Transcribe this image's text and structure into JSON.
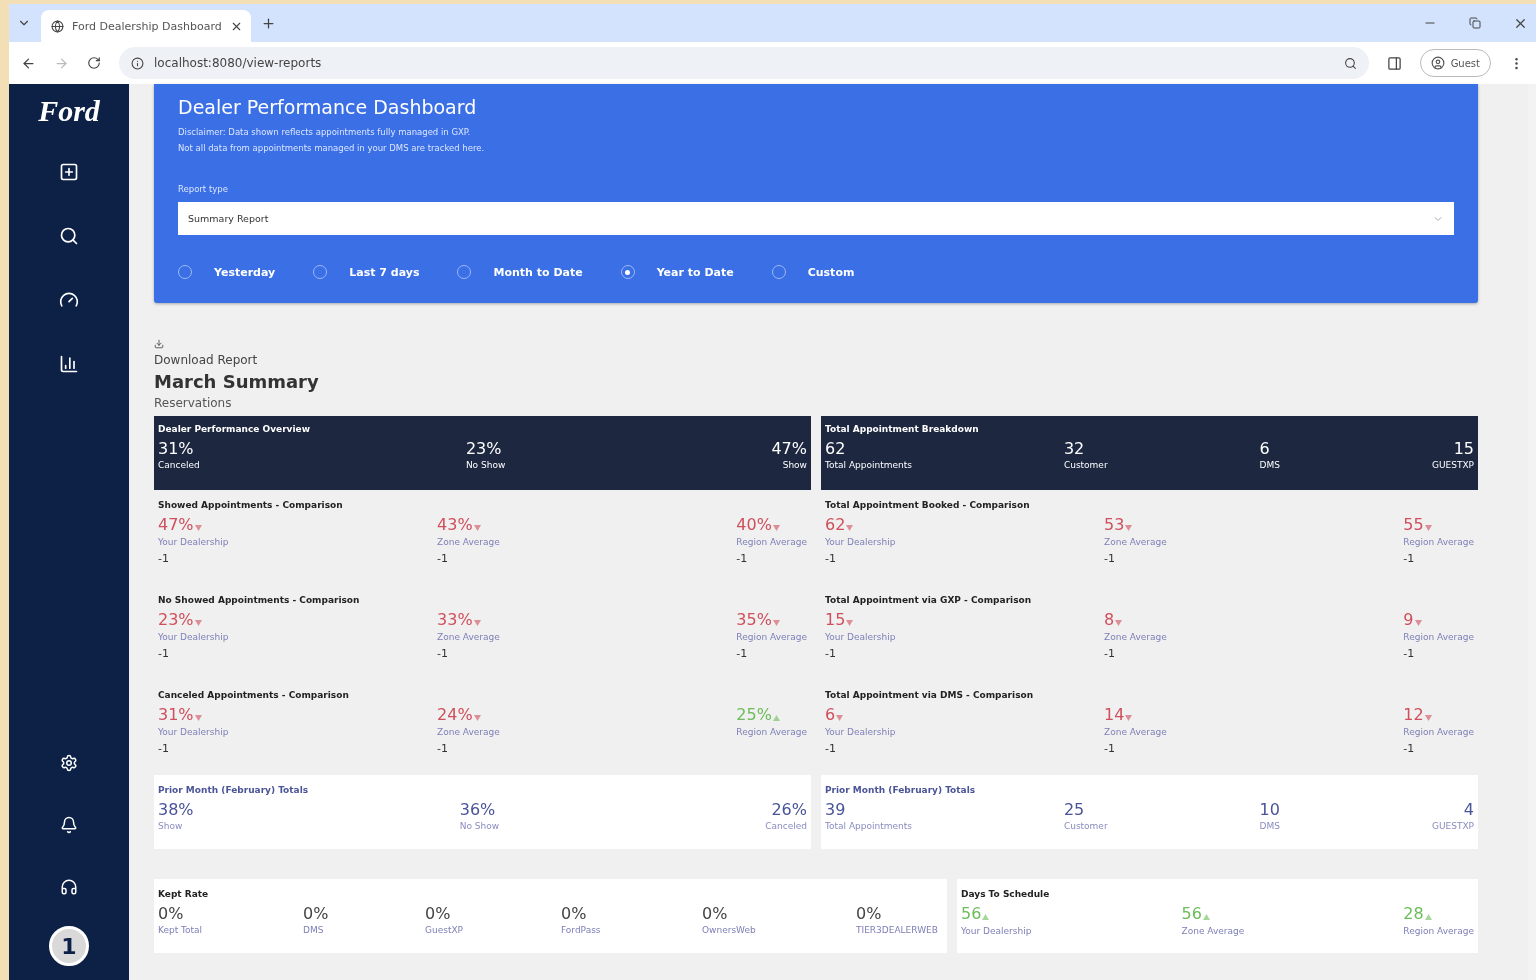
{
  "browser": {
    "tab_title": "Ford Dealership Dashboard",
    "url": "localhost:8080/view-reports",
    "profile": "Guest"
  },
  "sidebar": {
    "logo": "Ford",
    "avatar": "1"
  },
  "header": {
    "title": "Dealer Performance Dashboard",
    "disclaimer": [
      "Disclaimer: Data shown reflects appointments fully managed in GXP.",
      "Not all data from appointments managed in your DMS are tracked here."
    ],
    "report_type_label": "Report type",
    "report_type_value": "Summary Report",
    "ranges": [
      {
        "label": "Yesterday",
        "selected": false
      },
      {
        "label": "Last 7 days",
        "selected": false
      },
      {
        "label": "Month to Date",
        "selected": false
      },
      {
        "label": "Year to Date",
        "selected": true
      },
      {
        "label": "Custom",
        "selected": false
      }
    ]
  },
  "download": "Download Report",
  "report_title": "March Summary",
  "section": "Reservations",
  "columns": [
    {
      "overview": {
        "title": "Dealer Performance Overview",
        "stats": [
          {
            "value": "31%",
            "label": "Canceled"
          },
          {
            "value": "23%",
            "label": "No Show"
          },
          {
            "value": "47%",
            "label": "Show"
          }
        ]
      },
      "comparisons": [
        {
          "title": "Showed Appointments - Comparison",
          "items": [
            {
              "value": "47%",
              "up": false,
              "label": "Your Dealership",
              "delta": "-1"
            },
            {
              "value": "43%",
              "up": false,
              "label": "Zone Average",
              "delta": "-1"
            },
            {
              "value": "40%",
              "up": false,
              "label": "Region Average",
              "delta": "-1"
            }
          ]
        },
        {
          "title": "No Showed Appointments - Comparison",
          "items": [
            {
              "value": "23%",
              "up": false,
              "label": "Your Dealership",
              "delta": "-1"
            },
            {
              "value": "33%",
              "up": false,
              "label": "Zone Average",
              "delta": "-1"
            },
            {
              "value": "35%",
              "up": false,
              "label": "Region Average",
              "delta": "-1"
            }
          ]
        },
        {
          "title": "Canceled Appointments - Comparison",
          "items": [
            {
              "value": "31%",
              "up": false,
              "label": "Your Dealership",
              "delta": "-1"
            },
            {
              "value": "24%",
              "up": false,
              "label": "Zone Average",
              "delta": "-1"
            },
            {
              "value": "25%",
              "up": true,
              "label": "Region Average"
            }
          ]
        }
      ],
      "prior": {
        "title": "Prior Month (February) Totals",
        "stats": [
          {
            "value": "38%",
            "label": "Show"
          },
          {
            "value": "36%",
            "label": "No Show"
          },
          {
            "value": "26%",
            "label": "Canceled"
          }
        ]
      }
    },
    {
      "overview": {
        "title": "Total Appointment Breakdown",
        "stats": [
          {
            "value": "62",
            "label": "Total Appointments"
          },
          {
            "value": "32",
            "label": "Customer"
          },
          {
            "value": "6",
            "label": "DMS"
          },
          {
            "value": "15",
            "label": "GUESTXP"
          }
        ]
      },
      "comparisons": [
        {
          "title": "Total Appointment Booked - Comparison",
          "items": [
            {
              "value": "62",
              "up": false,
              "label": "Your Dealership",
              "delta": "-1"
            },
            {
              "value": "53",
              "up": false,
              "label": "Zone Average",
              "delta": "-1"
            },
            {
              "value": "55",
              "up": false,
              "label": "Region Average",
              "delta": "-1"
            }
          ]
        },
        {
          "title": "Total Appointment via GXP - Comparison",
          "items": [
            {
              "value": "15",
              "up": false,
              "label": "Your Dealership",
              "delta": "-1"
            },
            {
              "value": "8",
              "up": false,
              "label": "Zone Average",
              "delta": "-1"
            },
            {
              "value": "9",
              "up": false,
              "label": "Region Average",
              "delta": "-1"
            }
          ]
        },
        {
          "title": "Total Appointment via DMS - Comparison",
          "items": [
            {
              "value": "6",
              "up": false,
              "label": "Your Dealership",
              "delta": "-1"
            },
            {
              "value": "14",
              "up": false,
              "label": "Zone Average",
              "delta": "-1"
            },
            {
              "value": "12",
              "up": false,
              "label": "Region Average",
              "delta": "-1"
            }
          ]
        }
      ],
      "prior": {
        "title": "Prior Month (February) Totals",
        "stats": [
          {
            "value": "39",
            "label": "Total Appointments"
          },
          {
            "value": "25",
            "label": "Customer"
          },
          {
            "value": "10",
            "label": "DMS"
          },
          {
            "value": "4",
            "label": "GUESTXP"
          }
        ]
      }
    }
  ],
  "kept_rate": {
    "title": "Kept Rate",
    "stats": [
      {
        "value": "0%",
        "label": "Kept Total"
      },
      {
        "value": "0%",
        "label": "DMS"
      },
      {
        "value": "0%",
        "label": "GuestXP"
      },
      {
        "value": "0%",
        "label": "FordPass"
      },
      {
        "value": "0%",
        "label": "OwnersWeb"
      },
      {
        "value": "0%",
        "label": "TIER3DEALERWEB"
      }
    ]
  },
  "days_to_schedule": {
    "title": "Days To Schedule",
    "items": [
      {
        "value": "56",
        "up": true,
        "label": "Your Dealership"
      },
      {
        "value": "56",
        "up": true,
        "label": "Zone Average"
      },
      {
        "value": "28",
        "up": true,
        "label": "Region Average"
      }
    ]
  }
}
